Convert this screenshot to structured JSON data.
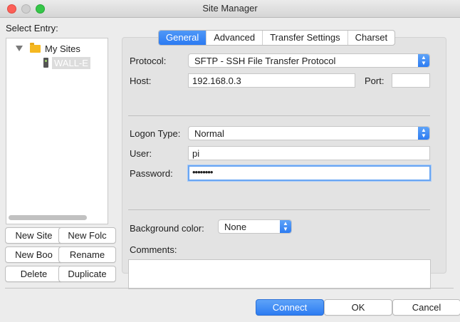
{
  "window": {
    "title": "Site Manager"
  },
  "select_entry_label": "Select Entry:",
  "tree": {
    "root_label": "My Sites",
    "sites": [
      {
        "label": "WALL-E",
        "selected": true
      }
    ]
  },
  "left_buttons": {
    "new_site": "New Site",
    "new_folder": "New Folc",
    "new_bookmark": "New Boo",
    "rename": "Rename",
    "delete": "Delete",
    "duplicate": "Duplicate"
  },
  "tabs": [
    {
      "label": "General",
      "active": true
    },
    {
      "label": "Advanced",
      "active": false
    },
    {
      "label": "Transfer Settings",
      "active": false
    },
    {
      "label": "Charset",
      "active": false
    }
  ],
  "general": {
    "protocol_label": "Protocol:",
    "protocol_value": "SFTP - SSH File Transfer Protocol",
    "host_label": "Host:",
    "host_value": "192.168.0.3",
    "port_label": "Port:",
    "port_value": "",
    "logon_type_label": "Logon Type:",
    "logon_type_value": "Normal",
    "user_label": "User:",
    "user_value": "pi",
    "password_label": "Password:",
    "password_value": "••••••••",
    "bg_color_label": "Background color:",
    "bg_color_value": "None",
    "comments_label": "Comments:",
    "comments_value": ""
  },
  "footer_buttons": {
    "connect": "Connect",
    "ok": "OK",
    "cancel": "Cancel"
  },
  "colors": {
    "accent": "#2d7cf2",
    "close": "#fc5f57",
    "maximize": "#35c648"
  }
}
